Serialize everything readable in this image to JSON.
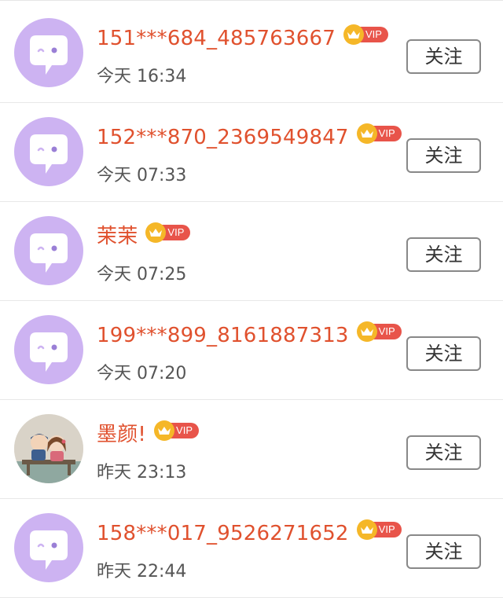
{
  "follow_list": {
    "items": [
      {
        "name": "151***684_485763667",
        "time": "今天 16:34",
        "vip": "VIP",
        "follow_label": "关注",
        "avatar": "default-bubble"
      },
      {
        "name": "152***870_2369549847",
        "time": "今天 07:33",
        "vip": "VIP",
        "follow_label": "关注",
        "avatar": "default-bubble"
      },
      {
        "name": "茉茉",
        "time": "今天 07:25",
        "vip": "VIP",
        "follow_label": "关注",
        "avatar": "default-bubble"
      },
      {
        "name": "199***899_8161887313",
        "time": "今天 07:20",
        "vip": "VIP",
        "follow_label": "关注",
        "avatar": "default-bubble"
      },
      {
        "name": "墨颜!",
        "time": "昨天 23:13",
        "vip": "VIP",
        "follow_label": "关注",
        "avatar": "photo-couple"
      },
      {
        "name": "158***017_9526271652",
        "time": "昨天 22:44",
        "vip": "VIP",
        "follow_label": "关注",
        "avatar": "default-bubble"
      }
    ]
  },
  "colors": {
    "name": "#e0512e",
    "vip_crown": "#f5b728",
    "vip_label": "#e8544a",
    "avatar_bg": "#cdb3f2",
    "time": "#555555",
    "divider": "#e8e8e8"
  }
}
